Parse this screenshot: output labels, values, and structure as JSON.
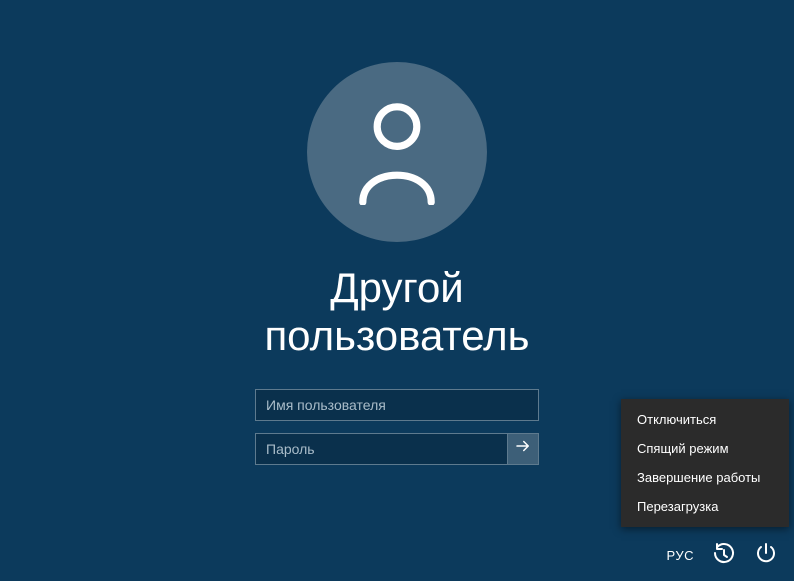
{
  "login": {
    "title": "Другой пользователь",
    "username_placeholder": "Имя пользователя",
    "password_placeholder": "Пароль"
  },
  "power_menu": {
    "items": [
      {
        "label": "Отключиться"
      },
      {
        "label": "Спящий режим"
      },
      {
        "label": "Завершение работы"
      },
      {
        "label": "Перезагрузка"
      }
    ]
  },
  "bottom": {
    "language": "РУС"
  }
}
